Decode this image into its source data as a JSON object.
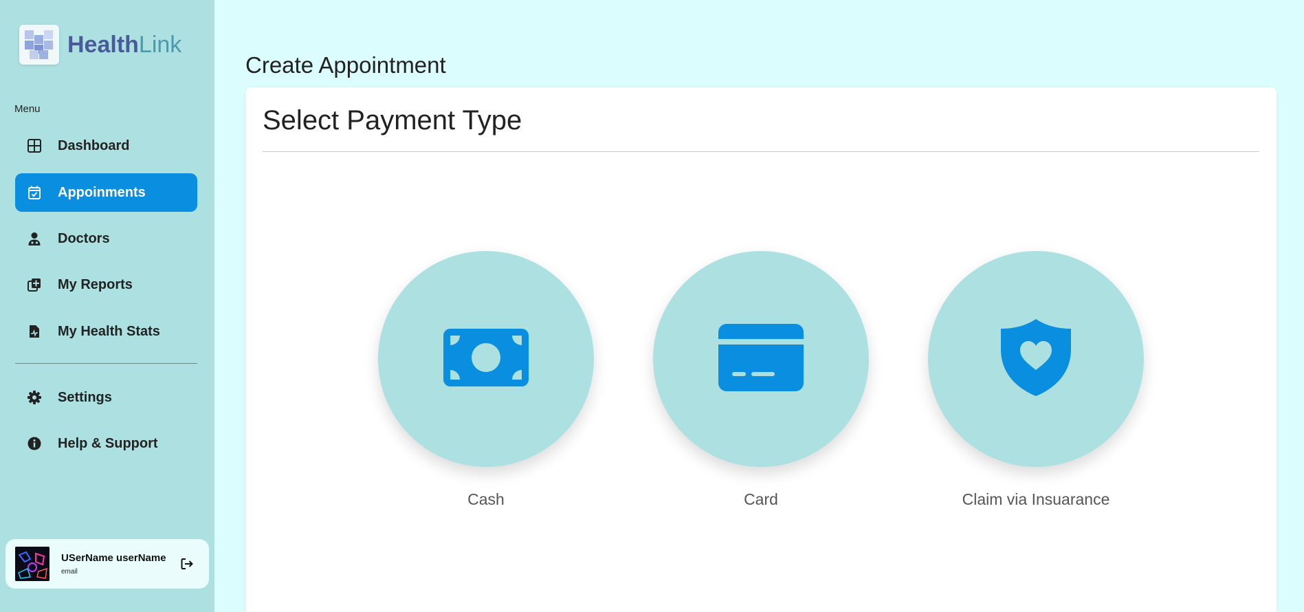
{
  "brand": {
    "name_part1": "Health",
    "name_part2": "Link"
  },
  "sidebar": {
    "menu_label": "Menu",
    "items": [
      {
        "label": "Dashboard",
        "icon": "grid-icon",
        "active": false
      },
      {
        "label": "Appoinments",
        "icon": "calendar-check-icon",
        "active": true
      },
      {
        "label": "Doctors",
        "icon": "doctor-icon",
        "active": false
      },
      {
        "label": "My Reports",
        "icon": "medical-report-icon",
        "active": false
      },
      {
        "label": "My Health Stats",
        "icon": "health-file-icon",
        "active": false
      }
    ],
    "bottom_items": [
      {
        "label": "Settings",
        "icon": "gear-icon"
      },
      {
        "label": "Help & Support",
        "icon": "info-icon"
      }
    ]
  },
  "user": {
    "name": "USerName userName",
    "email": "email",
    "logout_icon": "logout-icon"
  },
  "page": {
    "title": "Create Appointment"
  },
  "payment": {
    "title": "Select Payment Type",
    "options": [
      {
        "label": "Cash",
        "icon": "cash-icon"
      },
      {
        "label": "Card",
        "icon": "credit-card-icon"
      },
      {
        "label": "Claim via Insuarance",
        "icon": "shield-heart-icon"
      }
    ]
  },
  "colors": {
    "accent": "#0a8fe0",
    "sidebar_bg": "#ade1e1",
    "page_bg": "#dcfdfd",
    "circle_bg": "#ade1e1"
  }
}
